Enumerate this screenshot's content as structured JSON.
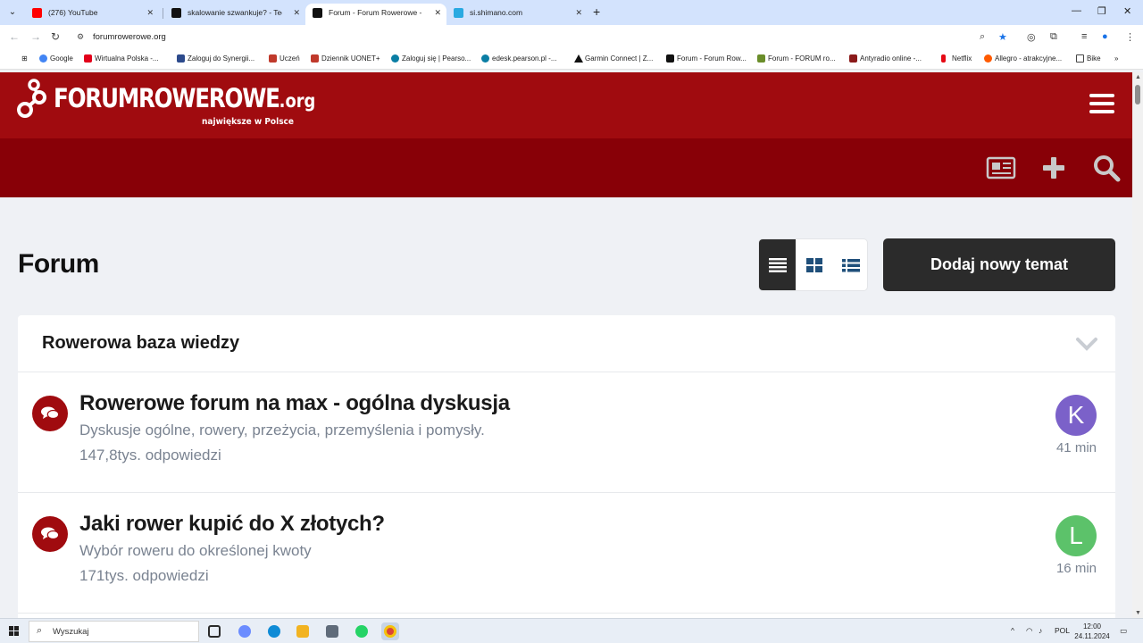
{
  "browser": {
    "tabs": [
      {
        "label": "(276) YouTube",
        "favicon_color": "#ff0000",
        "active": false
      },
      {
        "label": "skalowanie szwankuje? - Technic",
        "favicon_color": "#111111",
        "active": false
      },
      {
        "label": "Forum - Forum Rowerowe - Na",
        "favicon_color": "#111111",
        "active": true
      },
      {
        "label": "si.shimano.com",
        "favicon_color": "#29a9e1",
        "active": false
      }
    ],
    "url": "forumrowerowe.org",
    "bookmarks": [
      {
        "label": "Google",
        "color": "#4285f4"
      },
      {
        "label": "Wirtualna Polska -...",
        "color": "#e2001a"
      },
      {
        "label": "Zaloguj do Synergii...",
        "color": "#2c4a8c"
      },
      {
        "label": "Uczeń",
        "color": "#c0392b"
      },
      {
        "label": "Dziennik UONET+",
        "color": "#c0392b"
      },
      {
        "label": "Zaloguj się | Pearso...",
        "color": "#0a7ea4"
      },
      {
        "label": "edesk.pearson.pl -...",
        "color": "#0a7ea4"
      },
      {
        "label": "Garmin Connect | Z...",
        "color": "#111111"
      },
      {
        "label": "Forum - Forum Row...",
        "color": "#111111"
      },
      {
        "label": "Forum - FORUM ro...",
        "color": "#6a8d2a"
      },
      {
        "label": "Antyradio online -...",
        "color": "#8b1a1a"
      },
      {
        "label": "Netflix",
        "color": "#e50914"
      },
      {
        "label": "Allegro - atrakcyjne...",
        "color": "#ff5a00"
      },
      {
        "label": "Bike",
        "color": "#444444"
      }
    ]
  },
  "site": {
    "logo_main": "FORUMROWEROWE",
    "logo_tld": ".org",
    "logo_sub": "największe w Polsce",
    "brand_color": "#a00b0f",
    "brand_color_dark": "#880007"
  },
  "page": {
    "title": "Forum",
    "add_topic_label": "Dodaj nowy temat",
    "category": {
      "title": "Rowerowa baza wiedzy",
      "forums": [
        {
          "title": "Rowerowe forum na max - ogólna dyskusja",
          "description": "Dyskusje ogólne, rowery, przeżycia, przemyślenia i pomysły.",
          "replies": "147,8tys. odpowiedzi",
          "avatar_letter": "K",
          "avatar_color": "#7b61c9",
          "time": "41 min"
        },
        {
          "title": "Jaki rower kupić do X złotych?",
          "description": "Wybór roweru do określonej kwoty",
          "replies": "171tys. odpowiedzi",
          "avatar_letter": "L",
          "avatar_color": "#5cc26a",
          "time": "16 min"
        }
      ]
    }
  },
  "taskbar": {
    "search_placeholder": "Wyszukaj",
    "language": "POL",
    "time": "12:00",
    "date": "24.11.2024",
    "apps": [
      {
        "name": "task-view",
        "color": "#2b2b2b"
      },
      {
        "name": "copilot",
        "color": "#6b8cff"
      },
      {
        "name": "edge",
        "color": "#0f8bd6"
      },
      {
        "name": "file-explorer",
        "color": "#f2b321"
      },
      {
        "name": "calculator",
        "color": "#5f6b7a"
      },
      {
        "name": "whatsapp",
        "color": "#25d366"
      },
      {
        "name": "chrome",
        "color": "#db4437"
      }
    ]
  }
}
